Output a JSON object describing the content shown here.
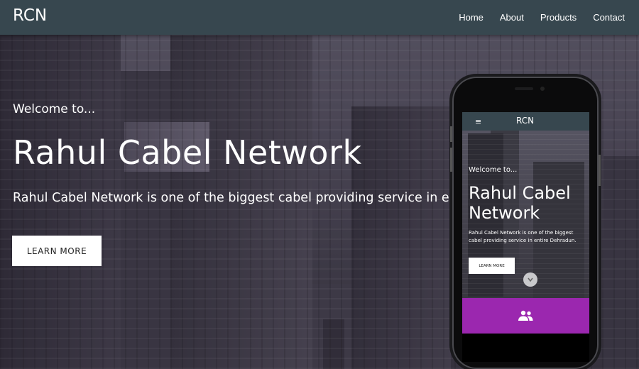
{
  "navbar": {
    "brand": "RCN",
    "links": [
      "Home",
      "About",
      "Products",
      "Contact"
    ]
  },
  "hero": {
    "welcome": "Welcome to...",
    "title": "Rahul Cabel Network",
    "description": "Rahul Cabel Network is one of the biggest cabel providing service in entire Dehradun.",
    "cta_label": "LEARN MORE"
  },
  "phone_preview": {
    "brand": "RCN",
    "menu_icon": "≡",
    "welcome": "Welcome to...",
    "title": "Rahul Cabel Network",
    "description": "Rahul Cabel Network is one of the biggest cabel providing service in entire Dehradun.",
    "cta_label": "LEARN MORE",
    "scroll_icon": "chevron-down-icon",
    "section_icon": "people-icon",
    "section_color": "#9b27af"
  },
  "colors": {
    "navbar": "#37474f",
    "text": "#ffffff",
    "button_bg": "#ffffff",
    "accent": "#9b27af"
  }
}
